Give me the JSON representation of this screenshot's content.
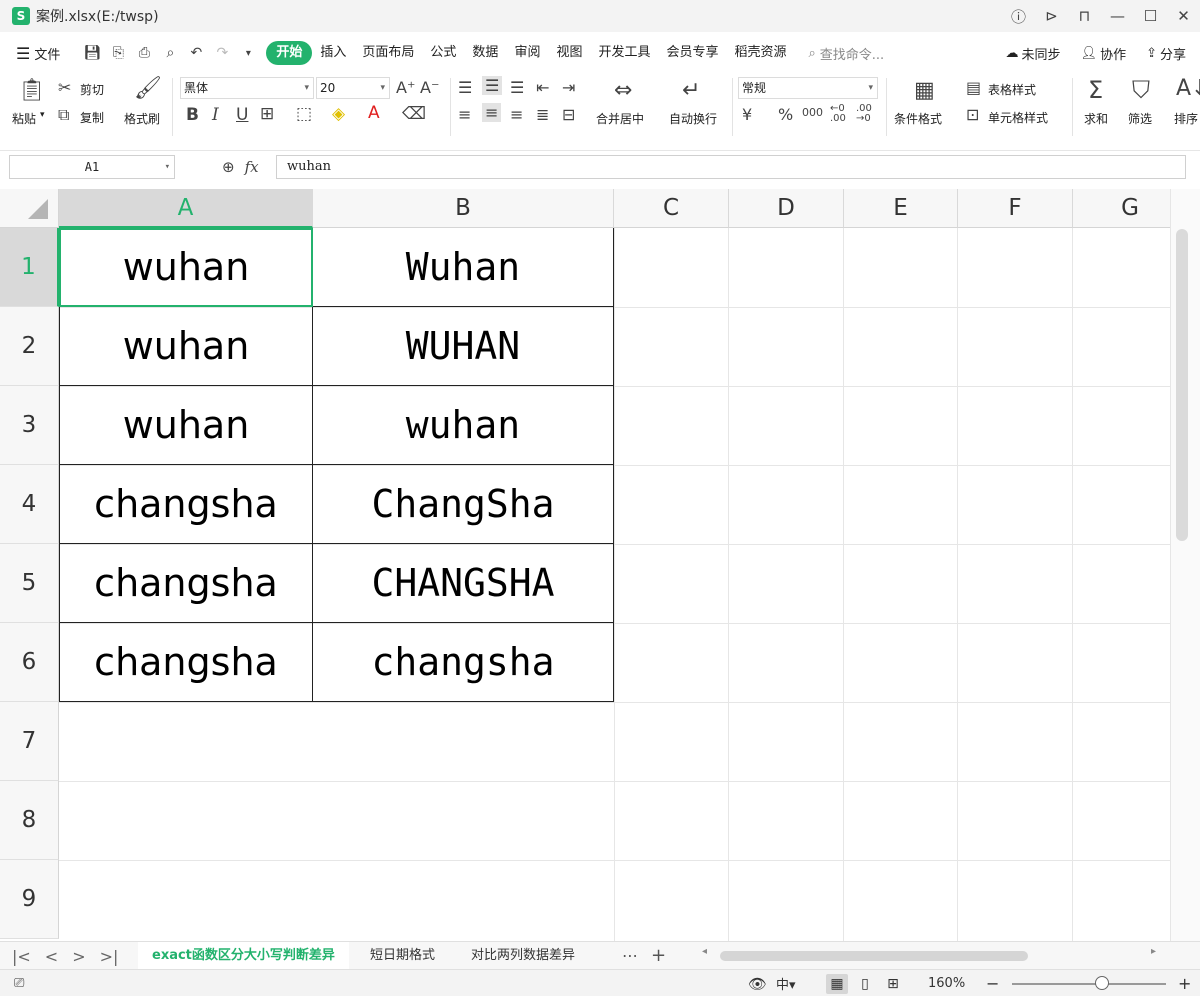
{
  "window": {
    "app_logo": "S",
    "file_title": "案例.xlsx(E:/twsp)",
    "controls": [
      "ⓘ",
      "⊳",
      "⊓",
      "—",
      "☐",
      "✕"
    ]
  },
  "menu": {
    "file_label": "文件",
    "tabs": [
      "开始",
      "插入",
      "页面布局",
      "公式",
      "数据",
      "审阅",
      "视图",
      "开发工具",
      "会员专享",
      "稻壳资源"
    ],
    "active_tab": "开始",
    "search_placeholder": "查找命令...",
    "unsynced": "未同步",
    "collab": "协作",
    "share": "分享"
  },
  "ribbon": {
    "paste": "粘贴",
    "cut": "剪切",
    "copy": "复制",
    "format_painter": "格式刷",
    "font_name": "黑体",
    "font_size": "20",
    "merge_center": "合并居中",
    "wrap_text": "自动换行",
    "number_format": "常规",
    "conditional_format": "条件格式",
    "table_style": "表格样式",
    "cell_style": "单元格样式",
    "sum": "求和",
    "filter": "筛选",
    "sort": "排序"
  },
  "formula_bar": {
    "name_box": "A1",
    "formula": "wuhan"
  },
  "sheet": {
    "columns": [
      "A",
      "B",
      "C",
      "D",
      "E",
      "F",
      "G"
    ],
    "selected_column": "A",
    "rows": [
      "1",
      "2",
      "3",
      "4",
      "5",
      "6",
      "7",
      "8",
      "9"
    ],
    "selected_row": "1",
    "cells": [
      [
        "wuhan",
        "Wuhan"
      ],
      [
        "wuhan",
        "WUHAN"
      ],
      [
        "wuhan",
        "wuhan"
      ],
      [
        "changsha",
        "ChangSha"
      ],
      [
        "changsha",
        "CHANGSHA"
      ],
      [
        "changsha",
        "changsha"
      ]
    ]
  },
  "sheet_tabs": {
    "tabs": [
      "exact函数区分大小写判断差异",
      "短日期格式",
      "对比两列数据差异"
    ],
    "active": "exact函数区分大小写判断差异"
  },
  "status": {
    "zoom": "160%"
  },
  "colors": {
    "accent": "#23b26d"
  }
}
